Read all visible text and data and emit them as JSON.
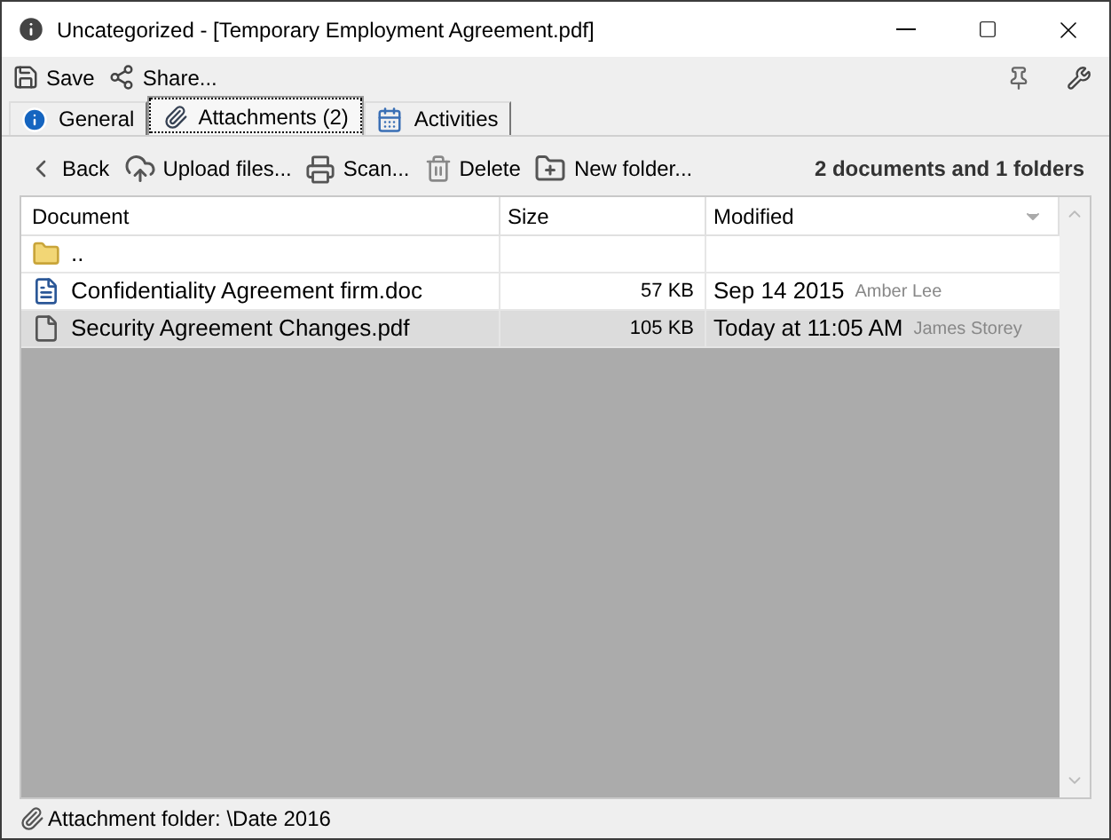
{
  "window": {
    "title": "Uncategorized - [Temporary Employment Agreement.pdf]"
  },
  "toolbar": [
    "Save",
    "Share..."
  ],
  "tabs": [
    {
      "label": "General",
      "selected": false,
      "kind": "info"
    },
    {
      "label": "Attachments (2)",
      "selected": true,
      "kind": "clip"
    },
    {
      "label": "Activities",
      "selected": false,
      "kind": "calendar"
    }
  ],
  "actions": [
    {
      "label": "Back",
      "kind": "back"
    },
    {
      "label": "Upload files...",
      "kind": "upload"
    },
    {
      "label": "Scan...",
      "kind": "scan"
    },
    {
      "label": "Delete",
      "kind": "delete"
    },
    {
      "label": "New folder...",
      "kind": "folder"
    }
  ],
  "summary": "2 documents and 1 folders",
  "table": {
    "columns": [
      "Document",
      "Size",
      "Modified"
    ],
    "rows": [
      {
        "kind": "folder",
        "name": "..",
        "selected": false
      },
      {
        "kind": "doc",
        "name": "Confidentiality Agreement firm.doc",
        "size": "57 KB",
        "date": "Sep 14 2015",
        "author": "Amber Lee",
        "selected": false
      },
      {
        "kind": "pdf",
        "name": "Security Agreement Changes.pdf",
        "size": "105 KB",
        "date": "Today at 11:05 AM",
        "author": "James Storey",
        "selected": true
      }
    ]
  },
  "status_bar": "Attachment folder: \\Date 2016"
}
